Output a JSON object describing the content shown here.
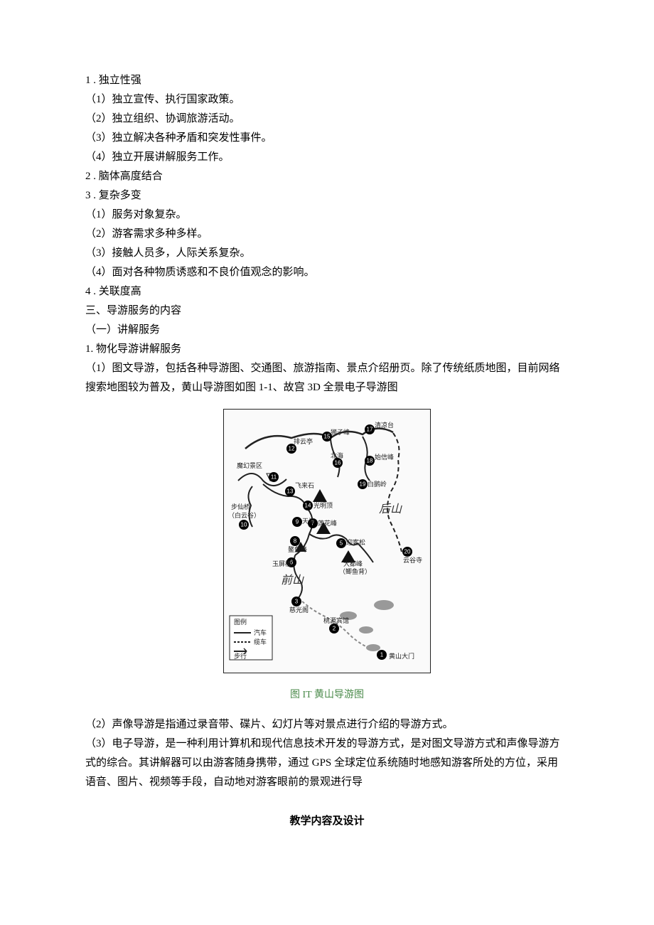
{
  "lines": {
    "l1": "1 . 独立性强",
    "l2": "（1）独立宣传、执行国家政策。",
    "l3": "（2）独立组织、协调旅游活动。",
    "l4": "（3）独立解决各种矛盾和突发性事件。",
    "l5": "（4）独立开展讲解服务工作。",
    "l6": "2 . 脑体高度结合",
    "l7": "3 . 复杂多变",
    "l8": "（1）服务对象复杂。",
    "l9": "（2）游客需求多种多样。",
    "l10": "（3）接触人员多，人际关系复杂。",
    "l11": "（4）面对各种物质诱惑和不良价值观念的影响。",
    "l12": "4 . 关联度高",
    "l13": "三、导游服务的内容",
    "l14": "（一）讲解服务",
    "l15": "1. 物化导游讲解服务",
    "l16": "（1）图文导游，包括各种导游图、交通图、旅游指南、景点介绍册页。除了传统纸质地图，目前网络搜索地图较为普及，黄山导游图如图 1-1、故宫 3D 全景电子导游图",
    "l17": "（2）声像导游是指通过录音带、碟片、幻灯片等对景点进行介绍的导游方式。",
    "l18": "（3）电子导游，是一种利用计算机和现代信息技术开发的导游方式，是对图文导游方式和声像导游方式的综合。其讲解器可以由游客随身携带，通过 GPS 全球定位系统随时地感知游客所处的方位，采用语音、图片、视频等手段，自动地对游客眼前的景观进行导"
  },
  "figure": {
    "caption": "图 IT 黄山导游图",
    "labels": {
      "paiyunting": "排云亭",
      "shizifeng": "狮子峰",
      "qingliangtai": "清凉台",
      "mohuanjingqu": "魔幻景区",
      "beihai": "北海",
      "shixinfeng": "始信峰",
      "feilaishi": "飞来石",
      "baieling": "白鹅岭",
      "buxianqiao1": "步仙桥",
      "buxianqiao2": "（白云谷）",
      "guangmingding": "光明顶",
      "houshan": "后山",
      "tianhai": "天海",
      "lianhuafeng": "莲花峰",
      "aoyufeng": "鳌鱼峰",
      "yingkesong": "迎客松",
      "yupinglou": "玉屏楼",
      "dadufeng1": "大都峰",
      "dadufeng2": "（鲫鱼背）",
      "qianshan": "前山",
      "yungusi": "云谷寺",
      "ciguangge": "慈光阁",
      "taoyuanbinguan": "桃源宾馆",
      "huangshandamen": "黄山大门",
      "legendTitle": "图例",
      "legendCar": "汽车",
      "legendCable": "缆车",
      "legendWalk": "步行"
    }
  },
  "heading": "教学内容及设计"
}
